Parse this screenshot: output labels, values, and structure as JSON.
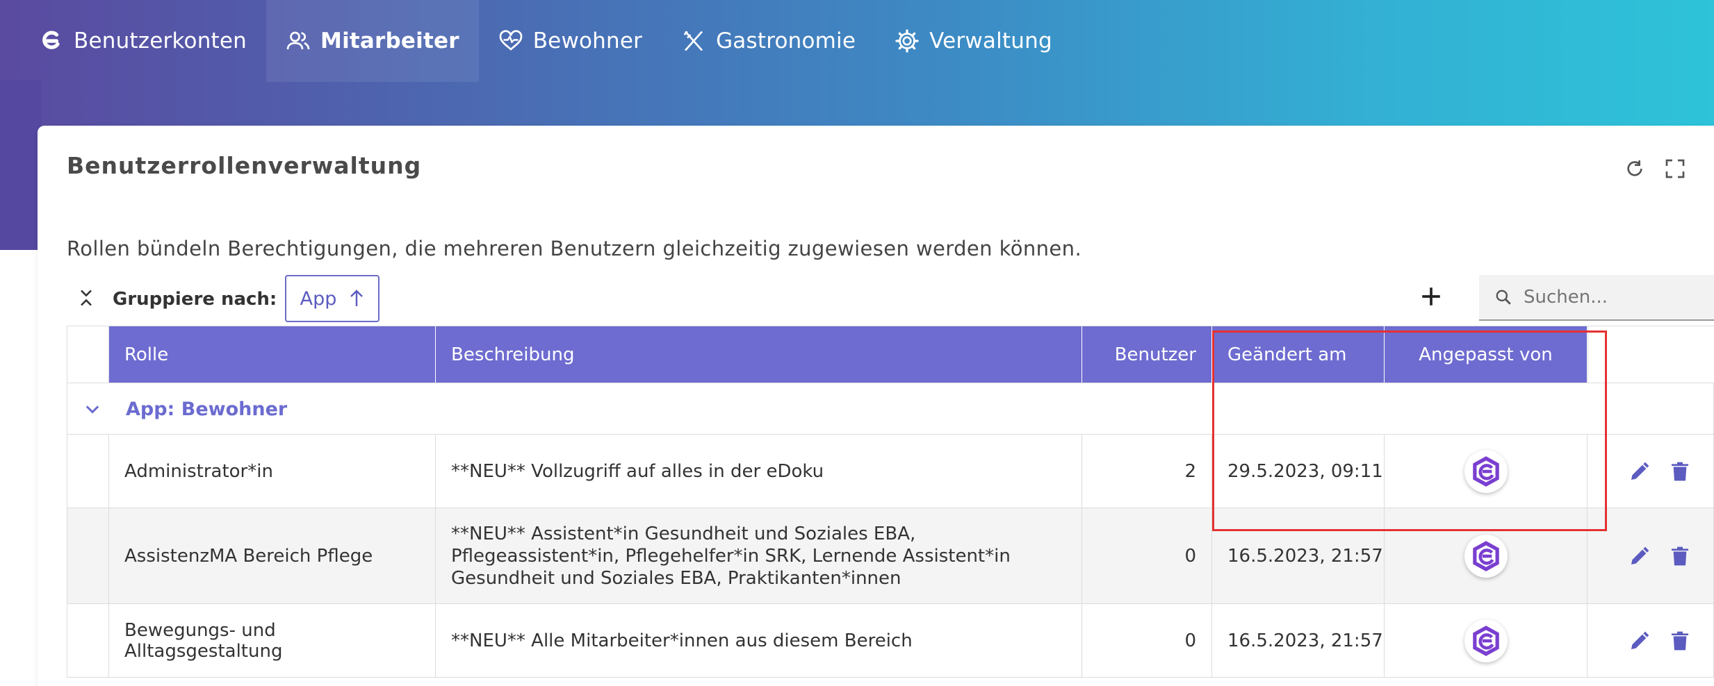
{
  "nav": {
    "items": [
      {
        "label": "Benutzerkonten",
        "icon": "edoku-logo-icon",
        "active": false
      },
      {
        "label": "Mitarbeiter",
        "icon": "users-icon",
        "active": true
      },
      {
        "label": "Bewohner",
        "icon": "heart-pulse-icon",
        "active": false
      },
      {
        "label": "Gastronomie",
        "icon": "fork-knife-icon",
        "active": false
      },
      {
        "label": "Verwaltung",
        "icon": "gear-icon",
        "active": false
      }
    ]
  },
  "card": {
    "title": "Benutzerrollenverwaltung",
    "description": "Rollen bündeln Berechtigungen, die mehreren Benutzern gleichzeitig zugewiesen werden können."
  },
  "toolbar": {
    "group_label": "Gruppiere nach:",
    "group_value": "App",
    "search_placeholder": "Suchen..."
  },
  "table": {
    "columns": {
      "rolle": "Rolle",
      "beschreibung": "Beschreibung",
      "benutzer": "Benutzer",
      "geaendert": "Geändert am",
      "angepasst": "Angepasst von"
    },
    "group": {
      "label": "App: Bewohner"
    },
    "rows": [
      {
        "rolle": "Administrator*in",
        "beschreibung": "**NEU** Vollzugriff auf alles in der eDoku",
        "benutzer": "2",
        "geaendert": "29.5.2023, 09:11"
      },
      {
        "rolle": "AssistenzMA Bereich Pflege",
        "beschreibung": "**NEU** Assistent*in Gesundheit und Soziales EBA, Pflegeassistent*in, Pflegehelfer*in SRK, Lernende Assistent*in Gesundheit und Soziales EBA, Praktikanten*innen",
        "benutzer": "0",
        "geaendert": "16.5.2023, 21:57"
      },
      {
        "rolle": "Bewegungs- und Alltagsgestaltung",
        "beschreibung": "**NEU** Alle Mitarbeiter*innen aus diesem Bereich",
        "benutzer": "0",
        "geaendert": "16.5.2023, 21:57"
      }
    ]
  },
  "colors": {
    "accent": "#6e6cd0",
    "highlight": "#e53131"
  }
}
